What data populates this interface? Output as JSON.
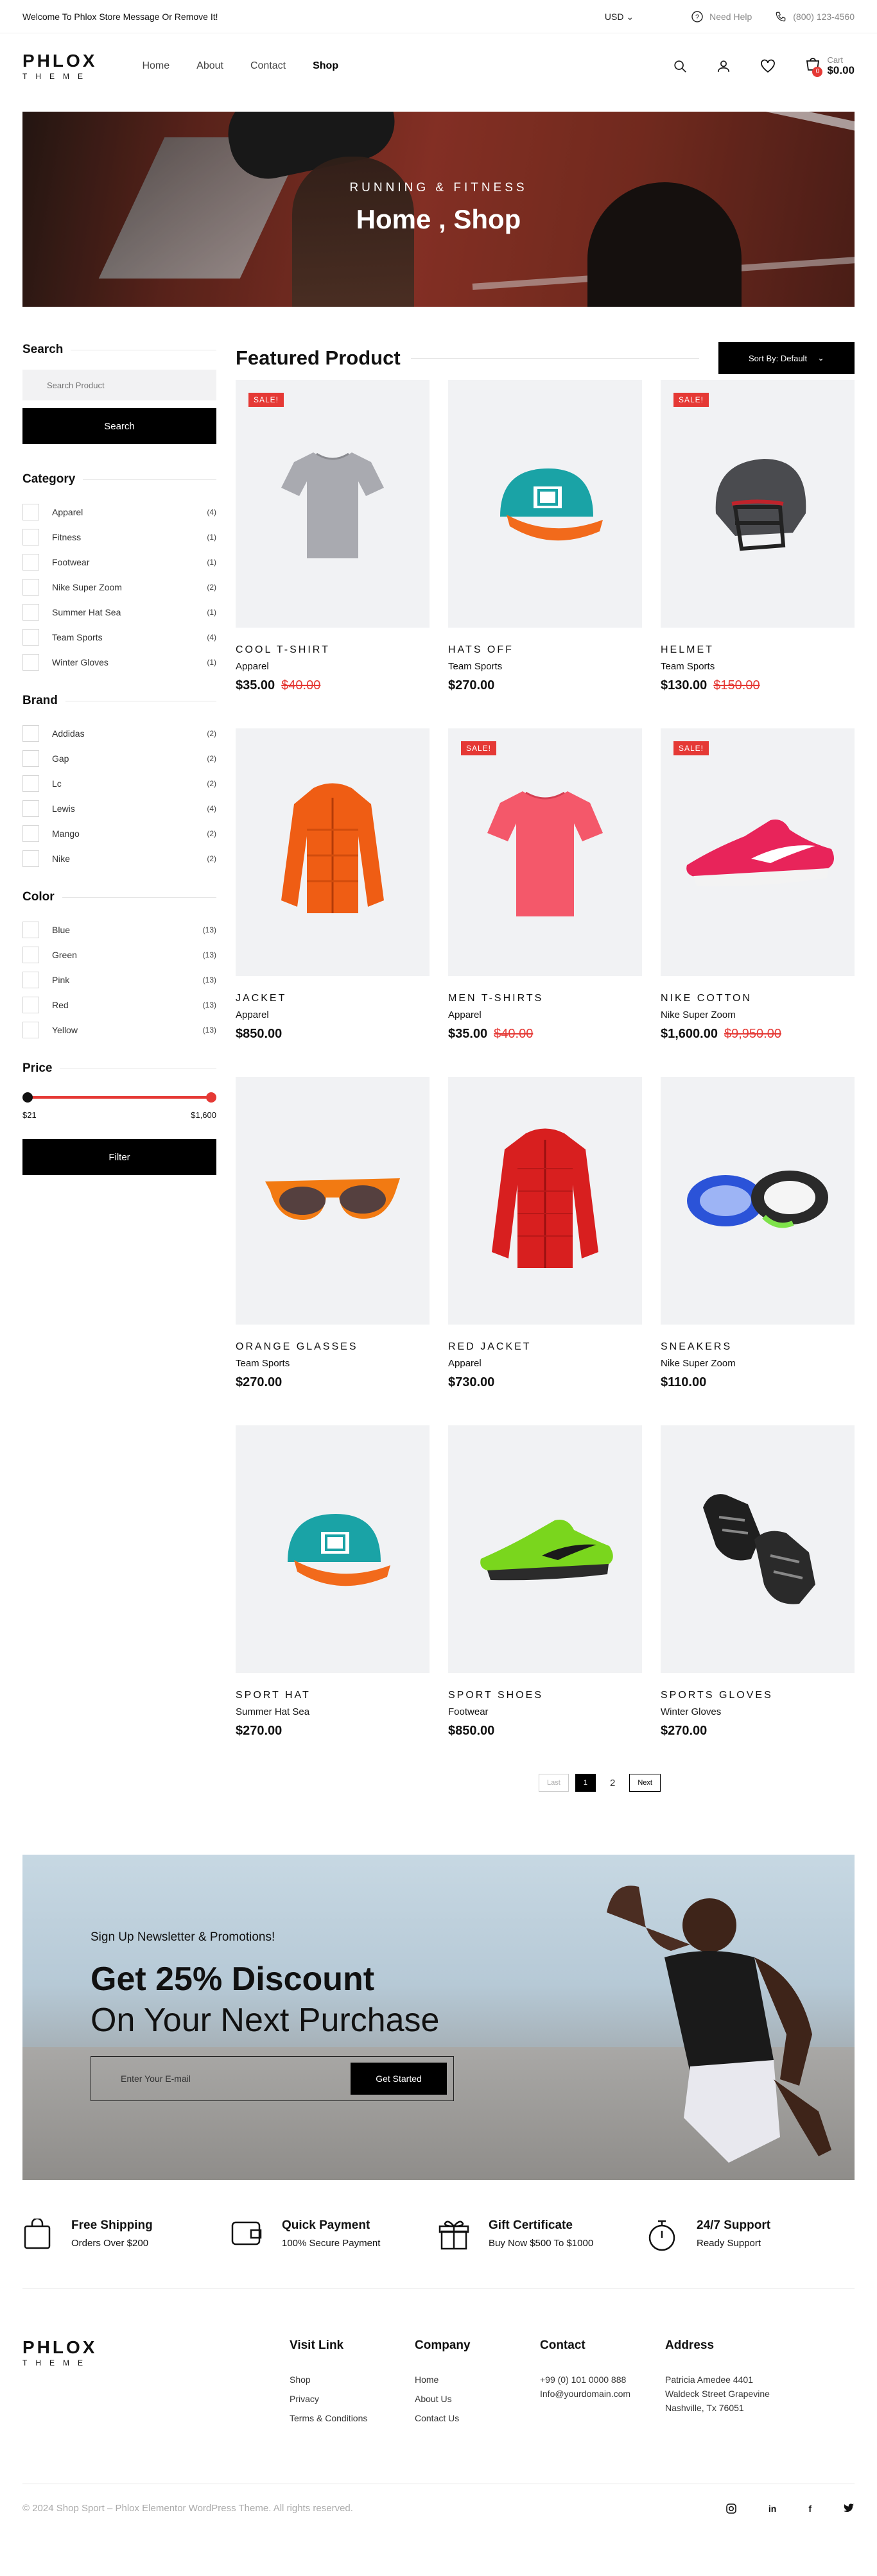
{
  "topbar": {
    "message": "Welcome To Phlox Store Message Or Remove It!",
    "currency": "USD",
    "help": "Need Help",
    "phone": "(800) 123-4560"
  },
  "header": {
    "logo_top": "PHLOX",
    "logo_bottom": "THEME",
    "nav": [
      "Home",
      "About",
      "Contact",
      "Shop"
    ],
    "active_nav": "Shop",
    "cart_label": "Cart",
    "cart_total": "$0.00",
    "cart_count": "0"
  },
  "hero": {
    "subtitle": "RUNNING & FITNESS",
    "title": "Home , Shop"
  },
  "sidebar": {
    "search_title": "Search",
    "search_placeholder": "Search Product",
    "search_button": "Search",
    "category_title": "Category",
    "categories": [
      {
        "label": "Apparel",
        "count": "(4)"
      },
      {
        "label": "Fitness",
        "count": "(1)"
      },
      {
        "label": "Footwear",
        "count": "(1)"
      },
      {
        "label": "Nike Super Zoom",
        "count": "(2)"
      },
      {
        "label": "Summer Hat Sea",
        "count": "(1)"
      },
      {
        "label": "Team Sports",
        "count": "(4)"
      },
      {
        "label": "Winter Gloves",
        "count": "(1)"
      }
    ],
    "brand_title": "Brand",
    "brands": [
      {
        "label": "Addidas",
        "count": "(2)"
      },
      {
        "label": "Gap",
        "count": "(2)"
      },
      {
        "label": "Lc",
        "count": "(2)"
      },
      {
        "label": "Lewis",
        "count": "(4)"
      },
      {
        "label": "Mango",
        "count": "(2)"
      },
      {
        "label": "Nike",
        "count": "(2)"
      }
    ],
    "color_title": "Color",
    "colors": [
      {
        "label": "Blue",
        "count": "(13)"
      },
      {
        "label": "Green",
        "count": "(13)"
      },
      {
        "label": "Pink",
        "count": "(13)"
      },
      {
        "label": "Red",
        "count": "(13)"
      },
      {
        "label": "Yellow",
        "count": "(13)"
      }
    ],
    "price_title": "Price",
    "price_min": "$21",
    "price_max": "$1,600",
    "filter_button": "Filter"
  },
  "products": {
    "title": "Featured Product",
    "sort_label": "Sort By: Default",
    "sale_badge": "SALE!",
    "items": [
      {
        "name": "COOL T-SHIRT",
        "category": "Apparel",
        "price": "$35.00",
        "old_price": "$40.00",
        "sale": true,
        "icon": "tshirt-grey-icon"
      },
      {
        "name": "HATS OFF",
        "category": "Team Sports",
        "price": "$270.00",
        "old_price": "",
        "sale": false,
        "icon": "cap-icon"
      },
      {
        "name": "HELMET",
        "category": "Team Sports",
        "price": "$130.00",
        "old_price": "$150.00",
        "sale": true,
        "icon": "helmet-icon"
      },
      {
        "name": "JACKET",
        "category": "Apparel",
        "price": "$850.00",
        "old_price": "",
        "sale": false,
        "icon": "jacket-orange-icon"
      },
      {
        "name": "MEN T-SHIRTS",
        "category": "Apparel",
        "price": "$35.00",
        "old_price": "$40.00",
        "sale": true,
        "icon": "tshirt-pink-icon"
      },
      {
        "name": "NIKE COTTON",
        "category": "Nike Super Zoom",
        "price": "$1,600.00",
        "old_price": "$9,950.00",
        "sale": true,
        "icon": "sneaker-pink-icon"
      },
      {
        "name": "ORANGE GLASSES",
        "category": "Team Sports",
        "price": "$270.00",
        "old_price": "",
        "sale": false,
        "icon": "glasses-icon"
      },
      {
        "name": "RED JACKET",
        "category": "Apparel",
        "price": "$730.00",
        "old_price": "",
        "sale": false,
        "icon": "jacket-red-icon"
      },
      {
        "name": "SNEAKERS",
        "category": "Nike Super Zoom",
        "price": "$110.00",
        "old_price": "",
        "sale": false,
        "icon": "sneakers-blue-icon"
      },
      {
        "name": "SPORT HAT",
        "category": "Summer Hat Sea",
        "price": "$270.00",
        "old_price": "",
        "sale": false,
        "icon": "cap-icon"
      },
      {
        "name": "SPORT SHOES",
        "category": "Footwear",
        "price": "$850.00",
        "old_price": "",
        "sale": false,
        "icon": "shoe-green-icon"
      },
      {
        "name": "SPORTS GLOVES",
        "category": "Winter Gloves",
        "price": "$270.00",
        "old_price": "",
        "sale": false,
        "icon": "gloves-icon"
      }
    ]
  },
  "pagination": {
    "prev": "Last",
    "current": "1",
    "next_page": "2",
    "next": "Next"
  },
  "newsletter": {
    "small": "Sign Up Newsletter & Promotions!",
    "headline": "Get 25% Discount",
    "headline2": "On Your Next Purchase",
    "placeholder": "Enter Your E-mail",
    "button": "Get Started"
  },
  "features": [
    {
      "title": "Free Shipping",
      "desc": "Orders Over $200",
      "icon": "bag-icon"
    },
    {
      "title": "Quick Payment",
      "desc": "100% Secure Payment",
      "icon": "wallet-icon"
    },
    {
      "title": "Gift Certificate",
      "desc": "Buy Now $500 To $1000",
      "icon": "gift-icon"
    },
    {
      "title": "24/7 Support",
      "desc": "Ready Support",
      "icon": "stopwatch-icon"
    }
  ],
  "footer": {
    "visit_title": "Visit Link",
    "visit_links": [
      "Shop",
      "Privacy",
      "Terms & Conditions"
    ],
    "company_title": "Company",
    "company_links": [
      "Home",
      "About Us",
      "Contact Us"
    ],
    "contact_title": "Contact",
    "contact_lines": [
      "+99 (0) 101 0000 888",
      "Info@yourdomain.com"
    ],
    "address_title": "Address",
    "address_lines": [
      "Patricia Amedee 4401",
      "Waldeck Street Grapevine",
      "Nashville, Tx 76051"
    ],
    "copyright": "© 2024 Shop Sport – Phlox Elementor WordPress Theme. All rights reserved.",
    "social": [
      "instagram-icon",
      "linkedin-icon",
      "facebook-icon",
      "twitter-icon"
    ]
  },
  "colors": {
    "accent": "#e53935",
    "dark": "#000000",
    "card_bg": "#f1f2f4"
  }
}
